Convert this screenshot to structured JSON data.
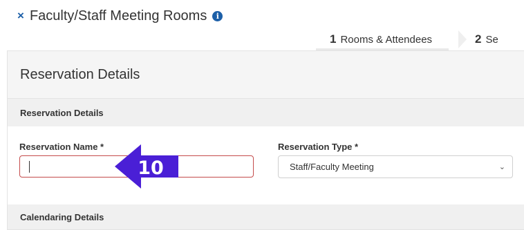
{
  "header": {
    "close_icon": "×",
    "title": "Faculty/Staff Meeting Rooms",
    "info_icon": "i"
  },
  "steps": [
    {
      "number": "1",
      "label": "Rooms & Attendees"
    },
    {
      "number": "2",
      "label": "Se"
    }
  ],
  "panel": {
    "heading": "Reservation Details",
    "section_title": "Reservation Details",
    "reservation_name": {
      "label": "Reservation Name *",
      "value": ""
    },
    "reservation_type": {
      "label": "Reservation Type *",
      "selected": "Staff/Faculty Meeting"
    },
    "calendaring_title": "Calendaring Details"
  },
  "annotation": {
    "number": "10",
    "color": "#4a1fd6"
  },
  "colors": {
    "accent": "#1c5fa8",
    "error_border": "#c44a4a"
  }
}
